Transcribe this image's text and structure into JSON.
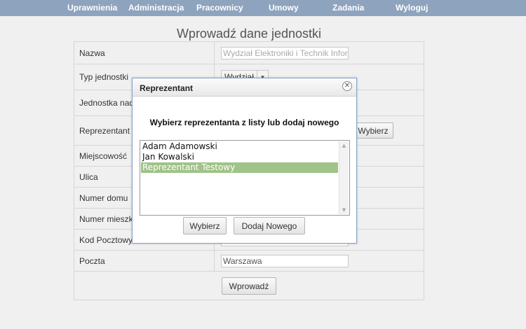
{
  "nav": {
    "items": [
      "Uprawnienia",
      "Administracja",
      "Pracownicy",
      "Umowy",
      "Zadania",
      "Wyloguj"
    ]
  },
  "page": {
    "title": "Wprowadź dane jednostki"
  },
  "form": {
    "nazwa": {
      "label": "Nazwa",
      "placeholder": "Wydział Elektroniki i Technik Informacyjnych"
    },
    "typ": {
      "label": "Typ jednostki",
      "value": "Wydział"
    },
    "nadrzedna": {
      "label": "Jednostka nadrzędna"
    },
    "reprezentant": {
      "label": "Reprezentant",
      "button": "Wybierz"
    },
    "miejscowosc": {
      "label": "Miejscowość"
    },
    "ulica": {
      "label": "Ulica"
    },
    "numer_domu": {
      "label": "Numer domu"
    },
    "numer_mieszkania": {
      "label": "Numer mieszkania"
    },
    "kod_pocztowy": {
      "label": "Kod Pocztowy"
    },
    "poczta": {
      "label": "Poczta",
      "value": "Warszawa"
    },
    "submit": "Wprowadź"
  },
  "dialog": {
    "title": "Reprezentant",
    "close_icon": "close-icon",
    "instruction": "Wybierz reprezentanta z listy lub dodaj nowego",
    "options": [
      "Adam Adamowski",
      "Jan Kowalski",
      "Reprezentant Testowy"
    ],
    "selected": "Reprezentant Testowy",
    "select_button": "Wybierz",
    "add_button": "Dodaj Nowego"
  },
  "colors": {
    "nav_bg": "#8ea3bd",
    "selection": "#a0c388",
    "dialog_border": "#86a4c8"
  }
}
